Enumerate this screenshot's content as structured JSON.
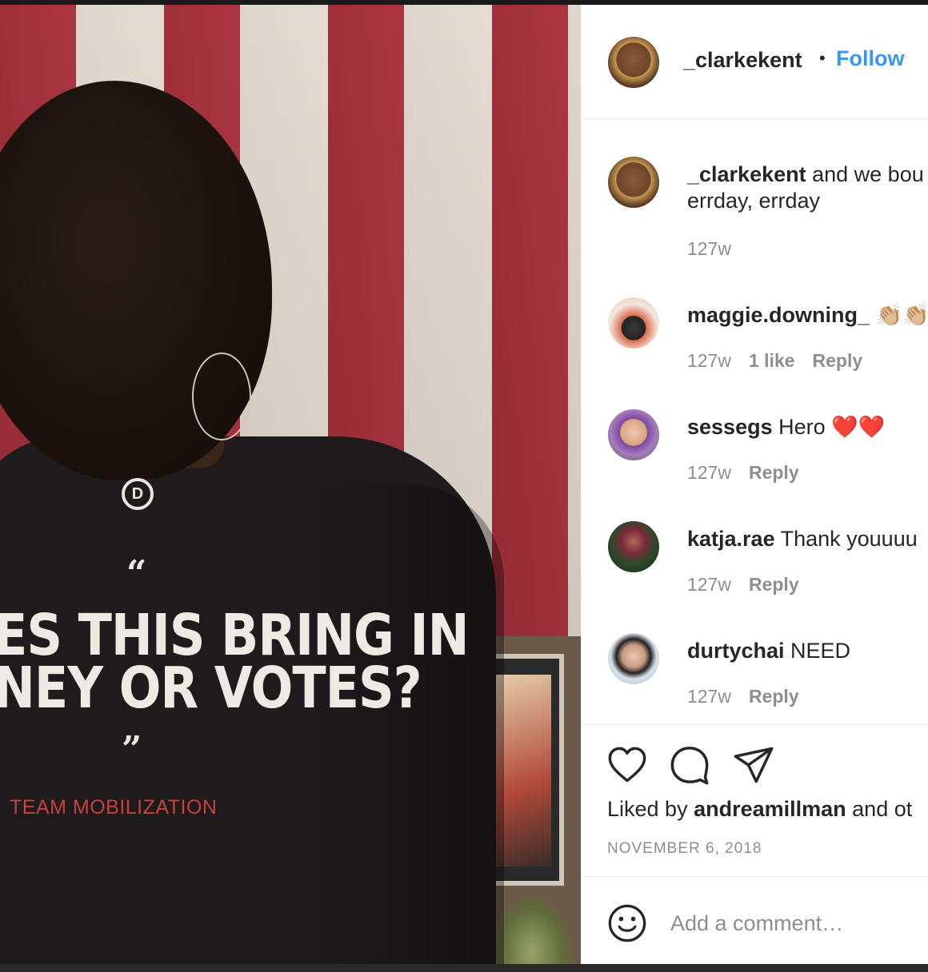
{
  "post": {
    "author": "_clarkekent",
    "follow_label": "Follow",
    "dot": "•",
    "shirt": {
      "line1": "ES THIS BRING IN",
      "line2": "NEY OR VOTES?",
      "team": "TEAM MOBILIZATION",
      "quote_open": "“",
      "quote_close": "”",
      "logo": "D"
    },
    "caption": {
      "user": "_clarkekent",
      "text1": " and we bou",
      "text2": "errday, errday",
      "age": "127w"
    }
  },
  "comments": [
    {
      "user": "maggie.downing_",
      "text": " 👏🏼👏🏼",
      "age": "127w",
      "likes": "1 like",
      "reply": "Reply"
    },
    {
      "user": "sessegs",
      "text": " Hero ❤️❤️",
      "age": "127w",
      "reply": "Reply"
    },
    {
      "user": "katja.rae",
      "text": " Thank youuuu",
      "age": "127w",
      "reply": "Reply"
    },
    {
      "user": "durtychai",
      "text": " NEED",
      "age": "127w",
      "reply": "Reply"
    }
  ],
  "actions": {
    "liked_prefix": "Liked by ",
    "liked_user": "andreamillman",
    "liked_suffix": " and ot",
    "date": "NOVEMBER 6, 2018",
    "icons": [
      "heart-icon",
      "comment-icon",
      "share-icon",
      "emoji-icon"
    ]
  },
  "add_comment": {
    "placeholder": "Add a comment…"
  },
  "colors": {
    "accent": "#3897f0",
    "text": "#262626",
    "muted": "#8e8e8e",
    "flag_red": "#b33844"
  }
}
